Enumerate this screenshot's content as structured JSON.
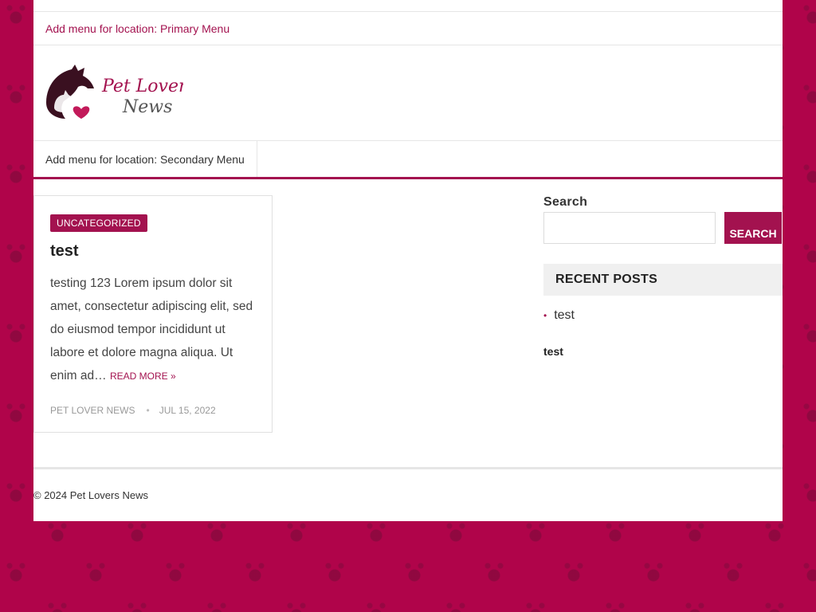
{
  "nav": {
    "primary_label": "Add menu for location: Primary Menu",
    "secondary_label": "Add menu for location: Secondary Menu"
  },
  "brand": {
    "logo_line1": "Pet Lovers",
    "logo_line2": "News"
  },
  "post": {
    "category": "UNCATEGORIZED",
    "title": "test",
    "excerpt": "testing 123   Lorem ipsum dolor sit amet, consectetur adipiscing elit, sed do eiusmod tempor incididunt ut labore et dolore magna aliqua. Ut enim ad…",
    "read_more": "READ MORE »",
    "author": "PET LOVER NEWS",
    "date": "JUL 15, 2022"
  },
  "sidebar": {
    "search_label": "Search",
    "search_button": "SEARCH",
    "recent_heading": "RECENT POSTS",
    "recent_posts": [
      "test"
    ],
    "extra_text": "test"
  },
  "footer": {
    "copyright": "© 2024 Pet Lovers News"
  },
  "colors": {
    "accent": "#a3124f",
    "background": "#b0044a"
  }
}
